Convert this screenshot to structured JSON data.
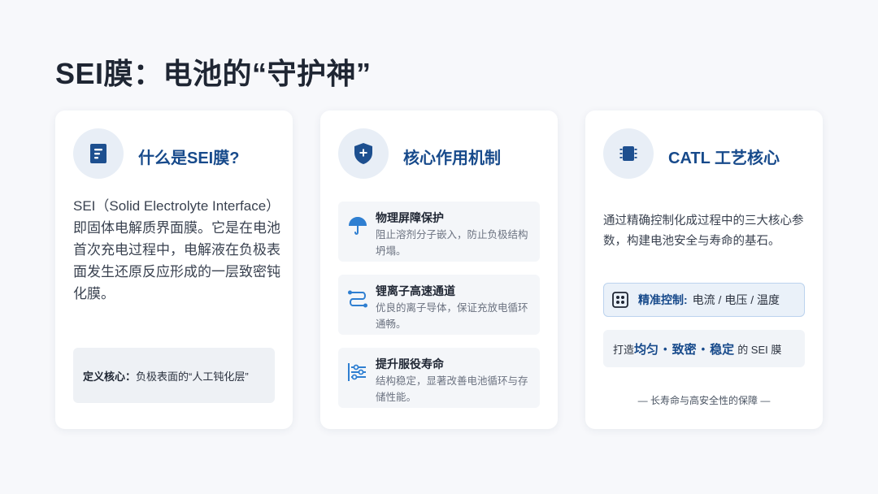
{
  "page": {
    "title": "SEI膜：电池的“守护神”"
  },
  "card1": {
    "icon": "document-icon",
    "title": "什么是SEI膜?",
    "description": "SEI（Solid Electrolyte Interface）即固体电解质界面膜。它是在电池首次充电过程中，电解液在负极表面发生还原反应形成的一层致密钝化膜。",
    "define_label": "定义核心：",
    "define_text": "负极表面的“人工钝化层”"
  },
  "card2": {
    "icon": "shield-plus-icon",
    "title": "核心作用机制",
    "items": [
      {
        "icon": "umbrella-icon",
        "title": "物理屏障保护",
        "desc": "阻止溶剂分子嵌入，防止负极结构坍塌。"
      },
      {
        "icon": "route-icon",
        "title": "锂离子高速通道",
        "desc": "优良的离子导体，保证充放电循环通畅。"
      },
      {
        "icon": "sliders-icon",
        "title": "提升服役寿命",
        "desc": "结构稳定，显著改善电池循环与存储性能。"
      }
    ]
  },
  "card3": {
    "icon": "chip-icon",
    "title": "CATL 工艺核心",
    "description": "通过精确控制化成过程中的三大核心参数，构建电池安全与寿命的基石。",
    "precise_icon": "control-panel-icon",
    "precise_label": "精准控制:",
    "precise_text": "电流 / 电压 / 温度",
    "make_prefix": "打造",
    "make_words": [
      "均匀",
      "致密",
      "稳定"
    ],
    "make_dot": "•",
    "make_suffix": "的 SEI 膜",
    "footer": "— 长寿命与高安全性的保障 —"
  },
  "colors": {
    "accent": "#174a8b",
    "icon_bg": "#e8eef6",
    "card_bg": "#ffffff",
    "page_bg": "#f7f8fb"
  }
}
